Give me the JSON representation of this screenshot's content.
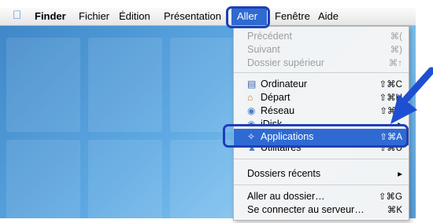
{
  "menubar": {
    "apple_icon": "apple-icon",
    "items": [
      "Finder",
      "Fichier",
      "Édition",
      "Présentation",
      "Aller",
      "Fenêtre",
      "Aide"
    ],
    "active": "Aller"
  },
  "menu": {
    "group1": [
      {
        "label": "Précédent",
        "shortcut": "⌘(",
        "enabled": false
      },
      {
        "label": "Suivant",
        "shortcut": "⌘)",
        "enabled": false
      },
      {
        "label": "Dossier supérieur",
        "shortcut": "⌘↑",
        "enabled": false
      }
    ],
    "group2": [
      {
        "label": "Ordinateur",
        "shortcut": "⇧⌘C",
        "icon": "computer-icon"
      },
      {
        "label": "Départ",
        "shortcut": "⇧⌘H",
        "icon": "home-icon"
      },
      {
        "label": "Réseau",
        "shortcut": "⇧⌘K",
        "icon": "network-icon"
      },
      {
        "label": "iDisk",
        "shortcut": "▸",
        "icon": "idisk-icon"
      },
      {
        "label": "Applications",
        "shortcut": "⇧⌘A",
        "icon": "applications-icon",
        "highlighted": true
      },
      {
        "label": "Utilitaires",
        "shortcut": "⇧⌘U",
        "icon": "utilities-icon"
      }
    ],
    "group3": [
      {
        "label": "Dossiers récents",
        "shortcut": "▸"
      }
    ],
    "group4": [
      {
        "label": "Aller au dossier…",
        "shortcut": "⇧⌘G"
      },
      {
        "label": "Se connecter au serveur…",
        "shortcut": "⌘K"
      }
    ]
  },
  "colors": {
    "highlight": "#2f6ad3",
    "callout": "#1f3fb5",
    "arrow": "#1f4fd1"
  }
}
